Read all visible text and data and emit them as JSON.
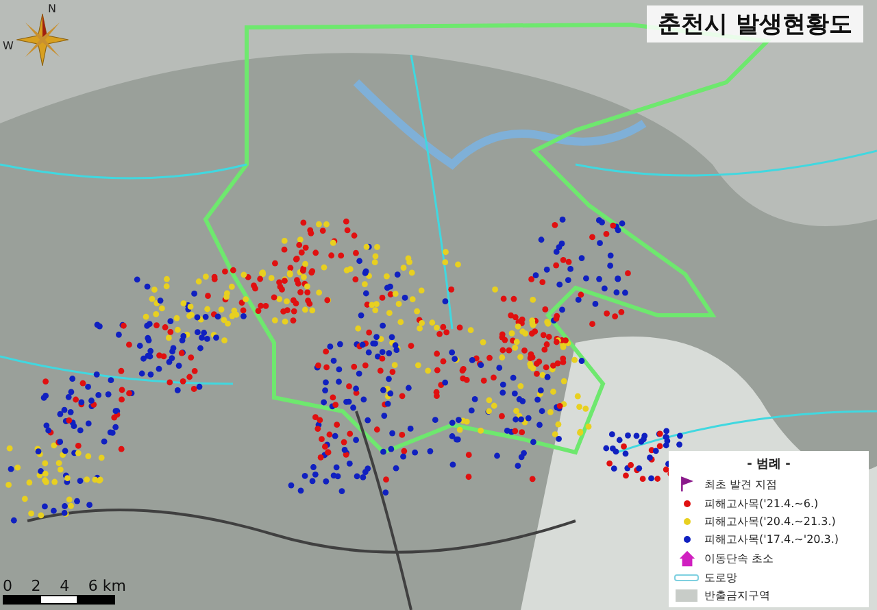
{
  "title": "춘천시 발생현황도",
  "compass": {
    "north": "N",
    "west": "W"
  },
  "scale": {
    "ticks": [
      "0",
      "2",
      "4",
      "6 km"
    ]
  },
  "legend": {
    "heading": "- 범례 -",
    "items": [
      {
        "kind": "flag",
        "label": "최초 발견 지점",
        "color": "#8b1a8b"
      },
      {
        "kind": "dot",
        "label": "피해고사목('21.4.~6.)",
        "color": "#e01010"
      },
      {
        "kind": "dot",
        "label": "피해고사목('20.4.~21.3.)",
        "color": "#e8d020"
      },
      {
        "kind": "dot",
        "label": "피해고사목('17.4.~'20.3.)",
        "color": "#1020c0"
      },
      {
        "kind": "post",
        "label": "이동단속 초소",
        "color": "#d020c0"
      },
      {
        "kind": "road",
        "label": "도로망",
        "color": "#7fd0e0"
      },
      {
        "kind": "zone",
        "label": "반출금지구역",
        "color": "#c8ccc8"
      }
    ]
  }
}
